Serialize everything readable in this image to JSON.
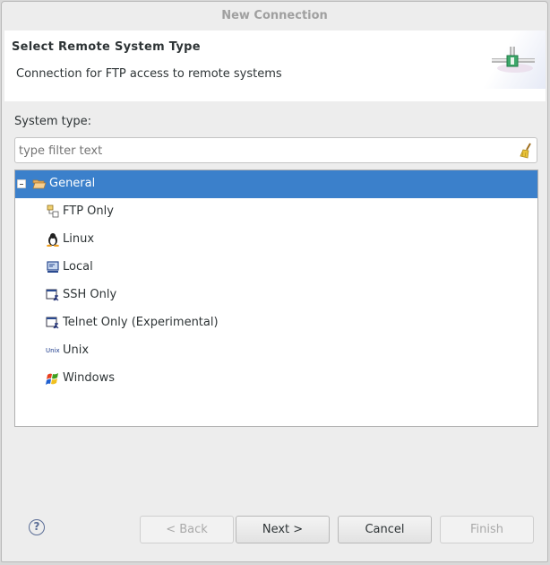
{
  "window": {
    "title": "New Connection"
  },
  "banner": {
    "title": "Select Remote System Type",
    "description": "Connection for FTP access to remote systems",
    "graphic": "network-connection-icon"
  },
  "system_type": {
    "label": "System type:",
    "filter": {
      "value": "",
      "placeholder": "type filter text",
      "clear_icon": "broom-clear-icon"
    }
  },
  "tree": {
    "group": {
      "label": "General",
      "expanded": true,
      "selected": true,
      "icon": "open-folder-icon"
    },
    "items": [
      {
        "label": "FTP Only",
        "icon": "ftp-icon"
      },
      {
        "label": "Linux",
        "icon": "linux-tux-icon"
      },
      {
        "label": "Local",
        "icon": "local-monitor-icon"
      },
      {
        "label": "SSH Only",
        "icon": "ssh-terminal-icon"
      },
      {
        "label": "Telnet Only (Experimental)",
        "icon": "telnet-terminal-icon"
      },
      {
        "label": "Unix",
        "icon": "unix-icon",
        "glyph": "Unix"
      },
      {
        "label": "Windows",
        "icon": "windows-flag-icon"
      }
    ]
  },
  "buttons": {
    "help": "?",
    "back": {
      "label": "< Back",
      "enabled": false
    },
    "next": {
      "label": "Next >",
      "enabled": true
    },
    "cancel": {
      "label": "Cancel",
      "enabled": true
    },
    "finish": {
      "label": "Finish",
      "enabled": false
    }
  },
  "colors": {
    "selection": "#3b80cb",
    "title_text": "#a0a0a0"
  }
}
